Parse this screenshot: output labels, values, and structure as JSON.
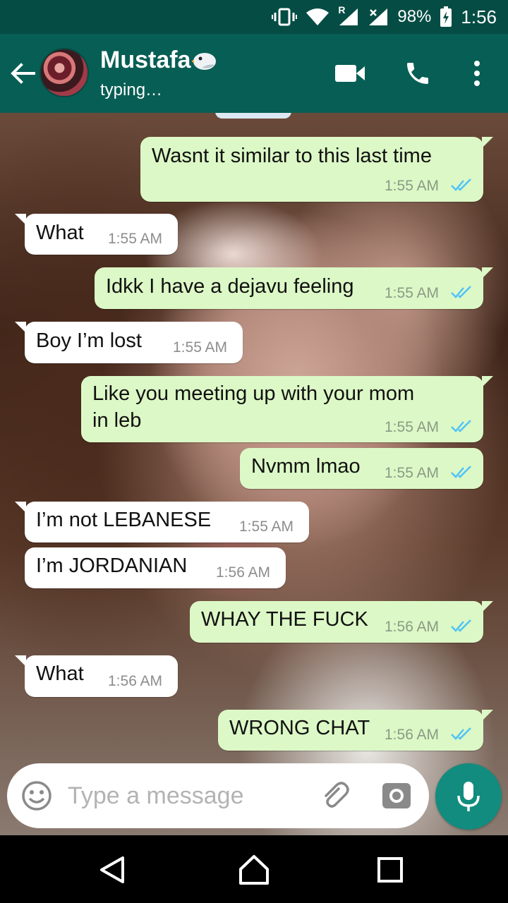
{
  "status_bar": {
    "roaming_label": "R",
    "battery": "98%",
    "time": "1:56"
  },
  "header": {
    "contact_name": "Mustafa",
    "contact_status": "typing…"
  },
  "messages": [
    {
      "dir": "out",
      "text": "Wasnt it similar to this last time",
      "time": "1:55 AM"
    },
    {
      "dir": "in",
      "text": "What",
      "time": "1:55 AM"
    },
    {
      "dir": "out",
      "text": "Idkk I have a dejavu feeling",
      "time": "1:55 AM"
    },
    {
      "dir": "in",
      "text": "Boy I’m lost",
      "time": "1:55 AM"
    },
    {
      "dir": "out",
      "text_line1": "Like you meeting up with your mom",
      "text_line2": "in leb",
      "time": "1:55 AM"
    },
    {
      "dir": "out",
      "text": "Nvmm lmao",
      "time": "1:55 AM"
    },
    {
      "dir": "in",
      "text": "I’m not LEBANESE",
      "time": "1:55 AM"
    },
    {
      "dir": "in",
      "text": "I’m JORDANIAN",
      "time": "1:56 AM"
    },
    {
      "dir": "out",
      "text": "WHAY THE FUCK",
      "time": "1:56 AM"
    },
    {
      "dir": "in",
      "text": "What",
      "time": "1:56 AM"
    },
    {
      "dir": "out",
      "text": "WRONG CHAT",
      "time": "1:56 AM"
    }
  ],
  "composer": {
    "placeholder": "Type a message"
  },
  "icons": {
    "status": [
      "vibrate-icon",
      "wifi-icon",
      "signal-icon",
      "signal-icon",
      "battery-charging-icon"
    ],
    "header": [
      "back-arrow-icon",
      "video-call-icon",
      "phone-icon",
      "more-vert-icon"
    ],
    "composer": [
      "emoji-icon",
      "attach-icon",
      "camera-icon",
      "mic-icon"
    ],
    "nav": [
      "back-triangle-icon",
      "home-icon",
      "recents-icon"
    ]
  },
  "colors": {
    "header": "#075e54",
    "status_bar": "#054d44",
    "outgoing_bubble": "#dcf8c6",
    "incoming_bubble": "#ffffff",
    "read_ticks": "#4fc3f7",
    "mic_button": "#128c7e"
  }
}
